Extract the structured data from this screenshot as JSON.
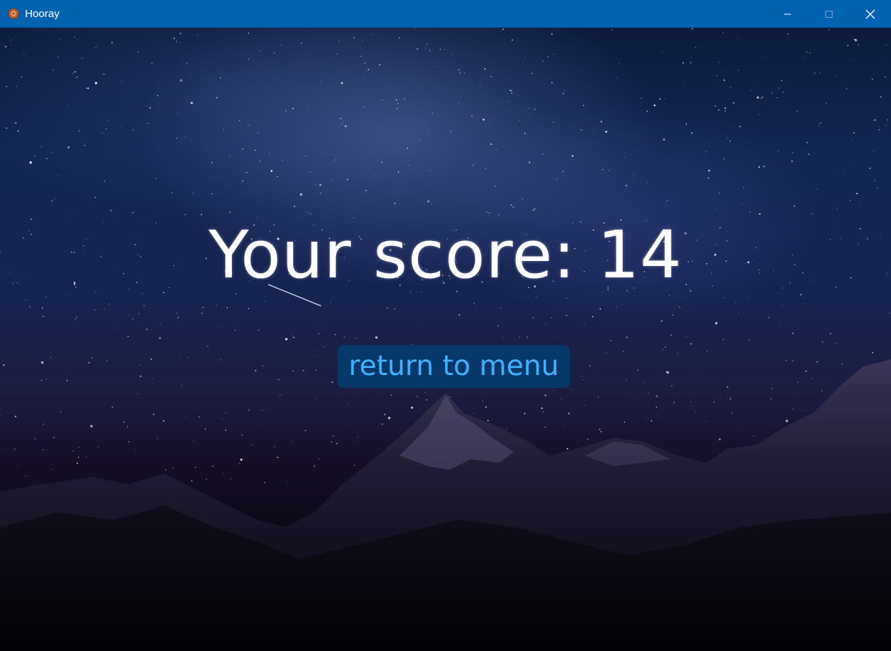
{
  "window": {
    "title": "Hooray",
    "icon": "gear-app-icon",
    "controls": {
      "minimize": "minimize-icon",
      "maximize": "maximize-icon",
      "close": "close-icon"
    }
  },
  "game": {
    "score_text": "Your score: 14",
    "score_value": 14,
    "return_button_label": "return to menu"
  },
  "colors": {
    "titlebar": "#0063b1",
    "button_bg": "#06386a",
    "button_text": "#3fb1ff",
    "score_text": "#ffffff"
  }
}
